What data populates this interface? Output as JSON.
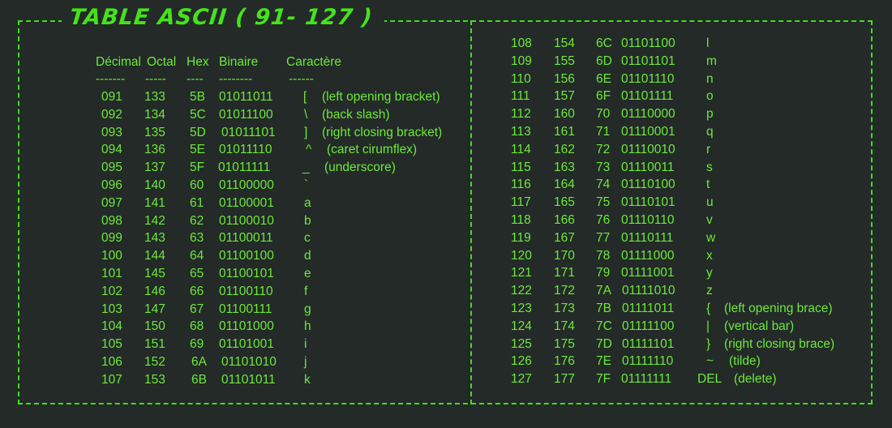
{
  "title": "TABLE ASCII ( 91- 127 )",
  "colors": {
    "background": "#232a28",
    "border": "#3fe01a",
    "text": "#6ee93a"
  },
  "headers": [
    "Décimal",
    "Octal",
    "Hex",
    "Binaire",
    "Caractère"
  ],
  "separators": [
    "-------",
    "-----",
    "----",
    "--------",
    "------"
  ],
  "left_rows": [
    [
      "091",
      "133",
      "5B",
      "01011011",
      "[",
      "(left opening bracket)"
    ],
    [
      "092",
      "134",
      "5C",
      "01011100",
      "\\",
      "(back slash)"
    ],
    [
      "093",
      "135",
      "5D",
      "01011101",
      "]",
      "(right closing bracket)"
    ],
    [
      "094",
      "136",
      "5E",
      "01011110",
      "^",
      "(caret cirumflex)"
    ],
    [
      "095",
      "137",
      "5F",
      "01011111",
      "_",
      "(underscore)"
    ],
    [
      "096",
      "140",
      "60",
      "01100000",
      "`",
      ""
    ],
    [
      "097",
      "141",
      "61",
      "01100001",
      "a",
      ""
    ],
    [
      "098",
      "142",
      "62",
      "01100010",
      "b",
      ""
    ],
    [
      "099",
      "143",
      "63",
      "01100011",
      "c",
      ""
    ],
    [
      "100",
      "144",
      "64",
      "01100100",
      "d",
      ""
    ],
    [
      "101",
      "145",
      "65",
      "01100101",
      "e",
      ""
    ],
    [
      "102",
      "146",
      "66",
      "01100110",
      "f",
      ""
    ],
    [
      "103",
      "147",
      "67",
      "01100111",
      "g",
      ""
    ],
    [
      "104",
      "150",
      "68",
      "01101000",
      "h",
      ""
    ],
    [
      "105",
      "151",
      "69",
      "01101001",
      "i",
      ""
    ],
    [
      "106",
      "152",
      "6A",
      "01101010",
      "j",
      ""
    ],
    [
      "107",
      "153",
      "6B",
      "01101011",
      "k",
      ""
    ]
  ],
  "right_rows": [
    [
      "108",
      "154",
      "6C",
      "01101100",
      "l",
      ""
    ],
    [
      "109",
      "155",
      "6D",
      "01101101",
      "m",
      ""
    ],
    [
      "110",
      "156",
      "6E",
      "01101110",
      "n",
      ""
    ],
    [
      "111",
      "157",
      "6F",
      "01101111",
      "o",
      ""
    ],
    [
      "112",
      "160",
      "70",
      "01110000",
      "p",
      ""
    ],
    [
      "113",
      "161",
      "71",
      "01110001",
      "q",
      ""
    ],
    [
      "114",
      "162",
      "72",
      "01110010",
      "r",
      ""
    ],
    [
      "115",
      "163",
      "73",
      "01110011",
      "s",
      ""
    ],
    [
      "116",
      "164",
      "74",
      "01110100",
      "t",
      ""
    ],
    [
      "117",
      "165",
      "75",
      "01110101",
      "u",
      ""
    ],
    [
      "118",
      "166",
      "76",
      "01110110",
      "v",
      ""
    ],
    [
      "119",
      "167",
      "77",
      "01110111",
      "w",
      ""
    ],
    [
      "120",
      "170",
      "78",
      "01111000",
      "x",
      ""
    ],
    [
      "121",
      "171",
      "79",
      "01111001",
      "y",
      ""
    ],
    [
      "122",
      "172",
      "7A",
      "01111010",
      "z",
      ""
    ],
    [
      "123",
      "173",
      "7B",
      "01111011",
      "{",
      "(left opening brace)"
    ],
    [
      "124",
      "174",
      "7C",
      "01111100",
      "|",
      "(vertical bar)"
    ],
    [
      "125",
      "175",
      "7D",
      "01111101",
      "}",
      "(right closing brace)"
    ],
    [
      "126",
      "176",
      "7E",
      "01111110",
      "~",
      "(tilde)"
    ],
    [
      "127",
      "177",
      "7F",
      "01111111",
      "DEL",
      "(delete)"
    ]
  ]
}
